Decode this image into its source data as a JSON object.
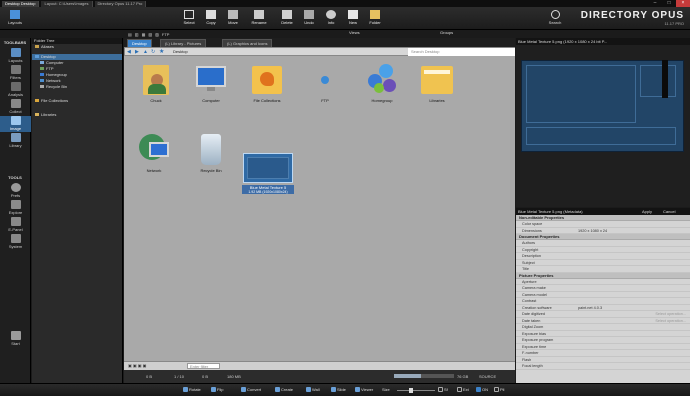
{
  "titlebar": {
    "tabs": [
      "Desktop Desktop",
      "Layout: C:\\Users\\Images",
      "Directory Opus 11.17 Pro"
    ],
    "controls": [
      "–",
      "□",
      "×"
    ]
  },
  "toolbar": {
    "layouts": "Layouts",
    "buttons": [
      "Select",
      "Copy",
      "Move",
      "Rename",
      "Delete",
      "Undo",
      "Info",
      "New",
      "Folder"
    ],
    "search": "Search",
    "brand": "DIRECTORY OPUS",
    "version": "11.17 PRO"
  },
  "minirow": {
    "ftp": "FTP",
    "views": "Views",
    "groups": "Groups"
  },
  "sidebar": {
    "toolbars_title": "TOOLBARS",
    "toolbars": [
      "Layouts",
      "Filters",
      "Analysis",
      "Collect",
      "Image",
      "Library"
    ],
    "tools_title": "TOOLS",
    "tools": [
      "Prefs",
      "Explore",
      "E-Panel",
      "System",
      "Start"
    ]
  },
  "foldertree": {
    "title": "Folder Tree",
    "items": [
      "Aliases",
      "Desktop",
      "Computer",
      "FTP",
      "Homegroup",
      "Network",
      "Recycle Bin",
      "File Collections",
      "Libraries"
    ]
  },
  "lister": {
    "tabs": [
      "Desktop",
      "(L) Library - Pictures",
      "(L) Graphics and Icons"
    ],
    "path": "Desktop",
    "search_placeholder": "Search Desktop",
    "files": [
      {
        "name": "Chuck",
        "sub": ""
      },
      {
        "name": "Computer",
        "sub": ""
      },
      {
        "name": "File Collections",
        "sub": ""
      },
      {
        "name": "FTP",
        "sub": ""
      },
      {
        "name": "Homegroup",
        "sub": ""
      },
      {
        "name": "Libraries",
        "sub": ""
      },
      {
        "name": "Network",
        "sub": ""
      },
      {
        "name": "Recycle Bin",
        "sub": ""
      },
      {
        "name": "Blue Metal Texture 5",
        "sub": "1.92 MB (1920x1080x24)"
      }
    ],
    "filter_placeholder": "Enter filter",
    "status": [
      "0 B",
      "1 / 10",
      "0 B",
      "180 MB",
      "76 GB",
      "SOURCE"
    ]
  },
  "preview": {
    "title": "Blue Metal Texture 5.png (1920 x 1080 x 24 bit P..."
  },
  "metadata": {
    "title": "Blue Metal Texture 5.png (Metadata)",
    "apply": "Apply",
    "cancel": "Cancel",
    "sections": [
      {
        "name": "Non-editable Properties",
        "rows": [
          [
            "Color space",
            ""
          ],
          [
            "Dimensions",
            "1920 x 1080 x 24"
          ]
        ]
      },
      {
        "name": "Document Properties",
        "rows": [
          [
            "Authors",
            ""
          ],
          [
            "Copyright",
            ""
          ],
          [
            "Description",
            ""
          ],
          [
            "Subject",
            ""
          ],
          [
            "Title",
            ""
          ]
        ]
      },
      {
        "name": "Picture Properties",
        "rows": [
          [
            "Aperture",
            ""
          ],
          [
            "Camera make",
            ""
          ],
          [
            "Camera model",
            ""
          ],
          [
            "Contrast",
            ""
          ],
          [
            "Creation software",
            "paint.net 4.0.3"
          ],
          [
            "Date digitized",
            "Select operation..."
          ],
          [
            "Date taken",
            "Select operation..."
          ],
          [
            "Digital Zoom",
            ""
          ],
          [
            "Exposure bias",
            ""
          ],
          [
            "Exposure program",
            ""
          ],
          [
            "Exposure time",
            ""
          ],
          [
            "F-number",
            ""
          ],
          [
            "Flash",
            ""
          ],
          [
            "Focal length",
            ""
          ]
        ]
      }
    ]
  },
  "bottombar": [
    "Rotate",
    "Flip",
    "Convert",
    "Create",
    "Wall",
    "Slide",
    "Viewer",
    "Size",
    "Sf",
    "Ext",
    "ON",
    "Pil"
  ]
}
